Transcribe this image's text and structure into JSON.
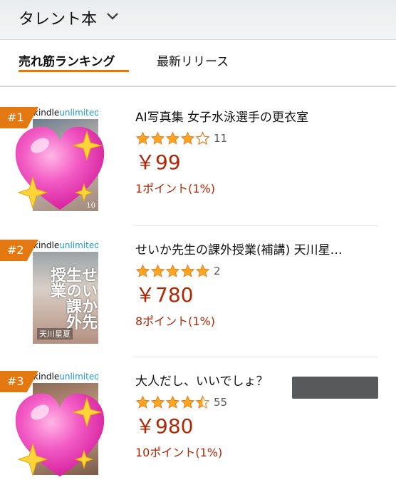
{
  "header": {
    "category_title": "タレント本"
  },
  "tabs": {
    "bestsellers": "売れ筋ランキング",
    "new_releases": "最新リリース"
  },
  "colors": {
    "accent": "#e47911",
    "price": "#b12704",
    "star": "#ffa41c"
  },
  "items": [
    {
      "rank": "#1",
      "badge": {
        "prefix": "k",
        "highlight": "indle",
        "suffix": "unlimited"
      },
      "title": "AI写真集 女子水泳選手の更衣室",
      "rating": 4,
      "rating_count": "11",
      "price": "￥99",
      "points": "1ポイント(1%)",
      "cover_num": "10",
      "cover_overlay": "heart-sparkle-emoji"
    },
    {
      "rank": "#2",
      "badge": {
        "prefix": "k",
        "highlight": "indle",
        "suffix": "unlimited"
      },
      "title": "せいか先生の課外授業(補講) 天川星…",
      "rating": 5,
      "rating_count": "2",
      "price": "￥780",
      "points": "8ポイント(1%)",
      "cover_vertical": "せいか先生の課外授業",
      "cover_name": "天川星夏"
    },
    {
      "rank": "#3",
      "badge": {
        "prefix": "k",
        "highlight": "indle",
        "suffix": "unlimited"
      },
      "title": "大人だし、いいでしょ？",
      "rating": 4.5,
      "rating_count": "55",
      "price": "￥980",
      "points": "10ポイント(1%)",
      "cover_overlay": "heart-sparkle-emoji"
    }
  ]
}
